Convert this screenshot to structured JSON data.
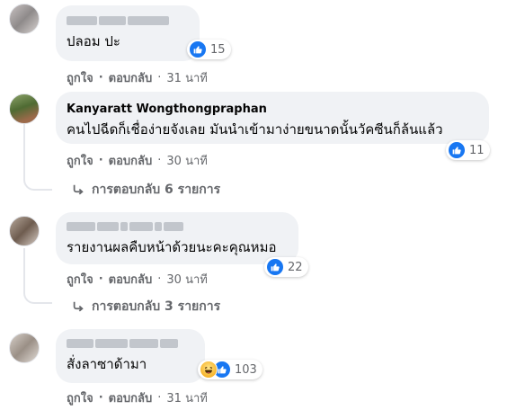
{
  "comments": [
    {
      "author": "",
      "text": "ปลอม ปะ",
      "reactions": {
        "icons": [
          "like-icon"
        ],
        "count": "15"
      },
      "actions": {
        "like": "ถูกใจ",
        "reply": "ตอบกลับ",
        "time": "31 นาที"
      }
    },
    {
      "author": "Kanyaratt Wongthongpraphan",
      "text": "คนไปฉีดก็เชื่อง่ายจังเลย มันนำเข้ามาง่ายขนาดนั้นวัคซีนก็ล้นแล้ว",
      "reactions": {
        "icons": [
          "like-icon"
        ],
        "count": "11"
      },
      "actions": {
        "like": "ถูกใจ",
        "reply": "ตอบกลับ",
        "time": "30 นาที"
      },
      "replies": "การตอบกลับ 6 รายการ"
    },
    {
      "author": "",
      "text": "รายงานผลคืบหน้าด้วยนะคะคุณหมอ",
      "reactions": {
        "icons": [
          "like-icon"
        ],
        "count": "22"
      },
      "actions": {
        "like": "ถูกใจ",
        "reply": "ตอบกลับ",
        "time": "30 นาที"
      },
      "replies": "การตอบกลับ 3 รายการ"
    },
    {
      "author": "",
      "text": "สั่งลาซาด้ามา",
      "reactions": {
        "icons": [
          "haha-icon",
          "like-icon"
        ],
        "count": "103"
      },
      "actions": {
        "like": "ถูกใจ",
        "reply": "ตอบกลับ",
        "time": "31 นาที"
      }
    }
  ],
  "separator": "·",
  "reply_arrow_icon": "reply-arrow-icon",
  "colors": {
    "like_blue": "#1877f2",
    "bubble_bg": "#f0f2f5",
    "meta_gray": "#65676b"
  }
}
